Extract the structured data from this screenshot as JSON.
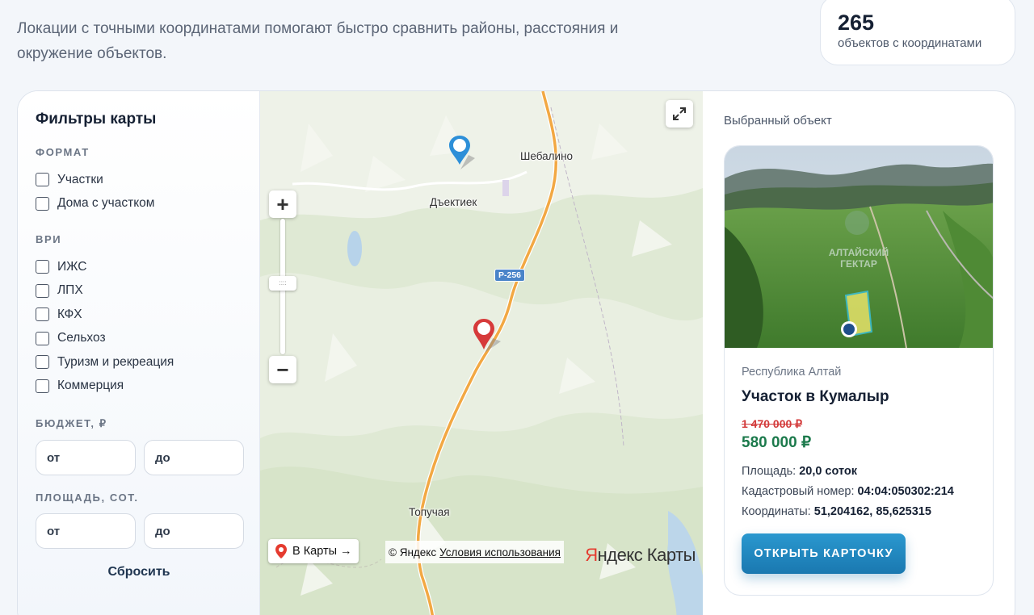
{
  "intro": {
    "text": "Локации с точными координатами помогают быстро сравнить районы, расстояния и окружение объектов."
  },
  "stats": {
    "count": "265",
    "label": "объектов с координатами"
  },
  "filters": {
    "title": "Фильтры карты",
    "format_label": "ФОРМАТ",
    "format_options": [
      "Участки",
      "Дома с участком"
    ],
    "vri_label": "ВРИ",
    "vri_options": [
      "ИЖС",
      "ЛПХ",
      "КФХ",
      "Сельхоз",
      "Туризм и рекреация",
      "Коммерция"
    ],
    "budget_label": "БЮДЖЕТ, ₽",
    "budget_from_placeholder": "от",
    "budget_to_placeholder": "до",
    "area_label": "ПЛОЩАДЬ, СОТ.",
    "area_from_placeholder": "от",
    "area_to_placeholder": "до",
    "reset_label": "Сбросить"
  },
  "map": {
    "labels": {
      "shebalino": "Шебалино",
      "dyektiek": "Дъектиек",
      "topuchaya": "Топучая"
    },
    "road_badge": "Р-256",
    "to_maps_label": "В Карты →",
    "copyright": "© Яндекс",
    "terms_link": "Условия использования",
    "logo_red": "Я",
    "logo_rest": "ндекс Карты",
    "pin_colors": {
      "selected": "#2d8fd8",
      "other": "#d63a3a"
    }
  },
  "selected": {
    "title": "Выбранный объект",
    "region": "Республика Алтай",
    "name": "Участок в Кумалыр",
    "old_price": "1 470 000 ₽",
    "price": "580 000 ₽",
    "area_label": "Площадь:",
    "area_value": "20,0 соток",
    "cadastre_label": "Кадастровый номер:",
    "cadastre_value": "04:04:050302:214",
    "coords_label": "Координаты:",
    "coords_value": "51,204162, 85,625315",
    "open_button": "ОТКРЫТЬ КАРТОЧКУ",
    "photo_watermark_line1": "АЛТАЙСКИЙ",
    "photo_watermark_line2": "ГЕКТАР"
  }
}
